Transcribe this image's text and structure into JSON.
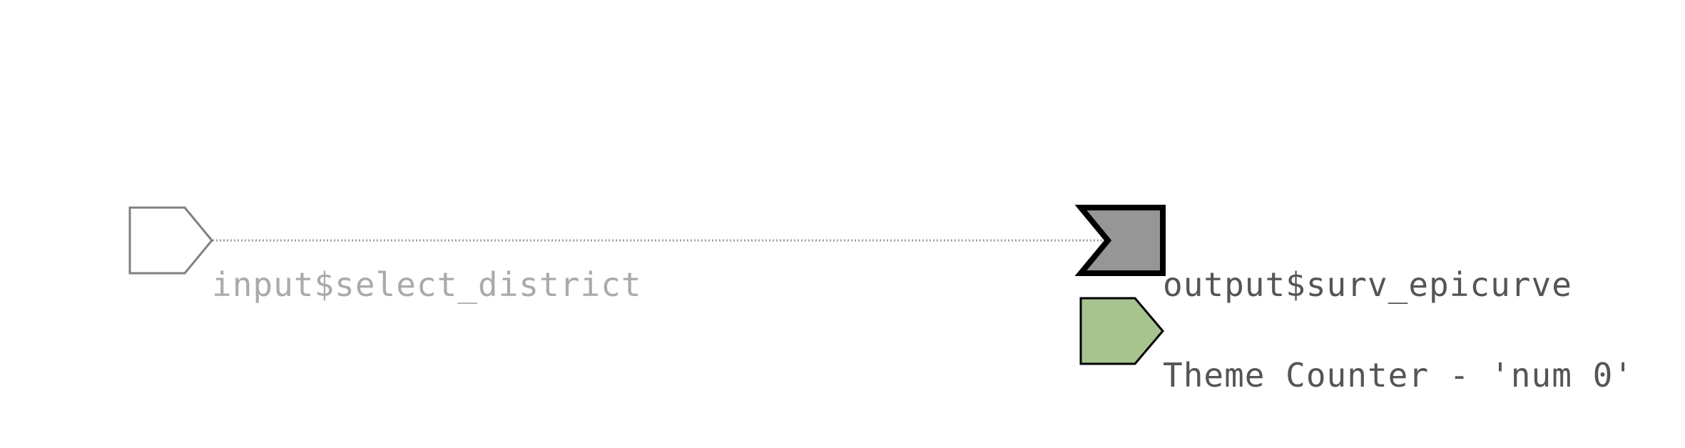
{
  "nodes": {
    "input_node": {
      "label": "input$select_district",
      "shape": "input-pentagon",
      "fill": "#ffffff",
      "stroke": "#808080",
      "label_color": "#aaaaaa"
    },
    "output_node": {
      "label": "output$surv_epicurve",
      "shape": "output-flag",
      "fill": "#969696",
      "stroke": "#000000",
      "label_color": "#555555"
    },
    "observer_node": {
      "label": "Theme Counter - 'num 0'",
      "shape": "observer-pentagon",
      "fill": "#a7c48f",
      "stroke": "#000000",
      "label_color": "#555555"
    }
  },
  "edges": [
    {
      "from": "input$select_district",
      "to": "output$surv_epicurve",
      "style": "dotted",
      "color": "#a0a0a0"
    }
  ]
}
